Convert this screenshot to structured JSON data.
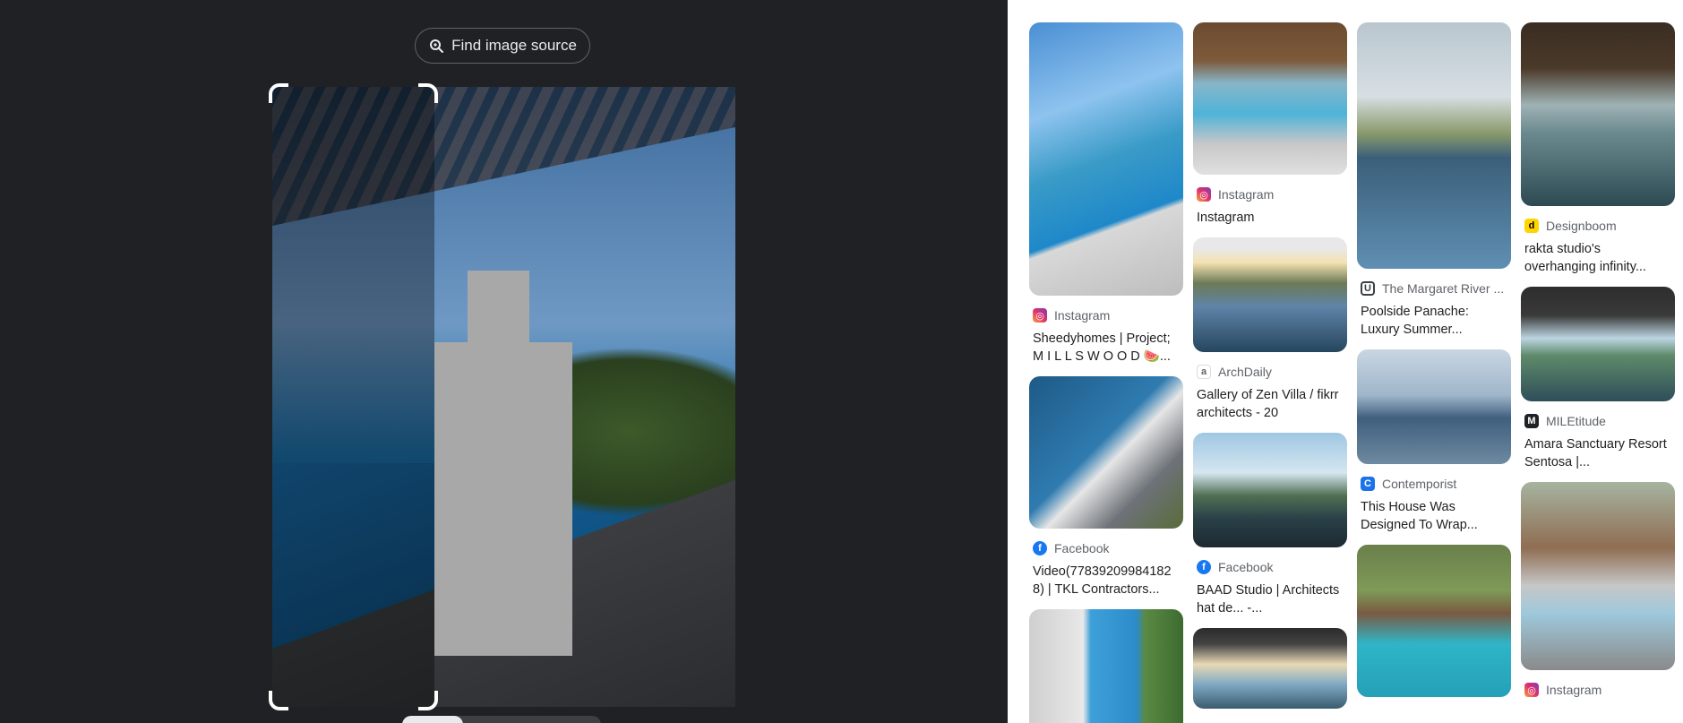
{
  "find_source": {
    "label": "Find image source",
    "icon": "lens-search-icon"
  },
  "results": {
    "col1": [
      {
        "source": "Instagram",
        "source_icon": "instagram-icon",
        "title": "Sheedyhomes | Project; M I L L S W O O D 🍉..."
      },
      {
        "source": "Facebook",
        "source_icon": "facebook-icon",
        "title": "Video(77839209984182 8) | TKL Contractors..."
      }
    ],
    "col2": [
      {
        "source": "Instagram",
        "source_icon": "instagram-icon",
        "title": "Instagram"
      },
      {
        "source": "ArchDaily",
        "source_icon": "archdaily-icon",
        "title": "Gallery of Zen Villa / fikrr architects - 20"
      },
      {
        "source": "Facebook",
        "source_icon": "facebook-icon",
        "title": "BAAD Studio | Architects hat de... -..."
      }
    ],
    "col3": [
      {
        "source": "The Margaret River ...",
        "source_icon": "margaret-river-icon",
        "title": "Poolside Panache: Luxury Summer..."
      },
      {
        "source": "Contemporist",
        "source_icon": "contemporist-icon",
        "title": "This House Was Designed To Wrap..."
      }
    ],
    "col4": [
      {
        "source": "Designboom",
        "source_icon": "designboom-icon",
        "title": "rakta studio's overhanging infinity..."
      },
      {
        "source": "MILEtitude",
        "source_icon": "miletitude-icon",
        "title": "Amara Sanctuary Resort Sentosa |..."
      },
      {
        "source": "Instagram",
        "source_icon": "instagram-icon",
        "title": ""
      }
    ]
  }
}
